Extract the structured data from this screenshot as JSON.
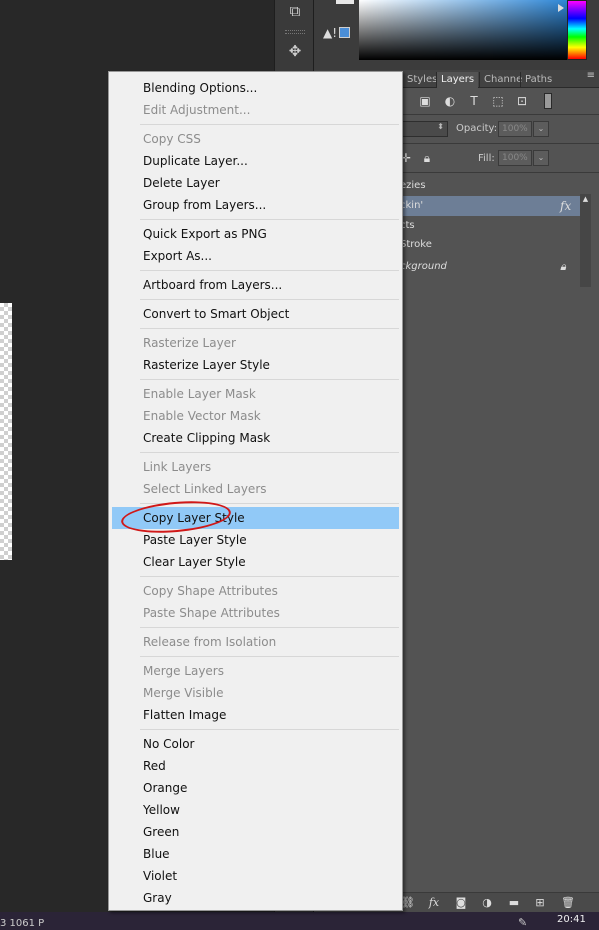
{
  "layers_panel": {
    "tabs": [
      {
        "label": "Styles",
        "active": false
      },
      {
        "label": "Layers",
        "active": true
      },
      {
        "label": "Channe",
        "active": false
      },
      {
        "label": "Paths",
        "active": false
      }
    ],
    "opacity_label": "Opacity:",
    "opacity_value": "100%",
    "fill_label": "Fill:",
    "fill_value": "100%",
    "layers": [
      {
        "name": "ezies",
        "selected": false
      },
      {
        "name": "ckin'",
        "selected": true,
        "badge": "fx"
      },
      {
        "name": "cts",
        "selected": false
      },
      {
        "name": "Stroke",
        "selected": false
      },
      {
        "name": "ckground",
        "selected": false,
        "locked": true
      }
    ]
  },
  "context_menu": {
    "items": [
      {
        "label": "Blending Options...",
        "enabled": true
      },
      {
        "label": "Edit Adjustment...",
        "enabled": false
      },
      {
        "label": "Copy CSS",
        "enabled": false
      },
      {
        "label": "Duplicate Layer...",
        "enabled": true
      },
      {
        "label": "Delete Layer",
        "enabled": true
      },
      {
        "label": "Group from Layers...",
        "enabled": true
      },
      {
        "label": "Quick Export as PNG",
        "enabled": true
      },
      {
        "label": "Export As...",
        "enabled": true
      },
      {
        "label": "Artboard from Layers...",
        "enabled": true
      },
      {
        "label": "Convert to Smart Object",
        "enabled": true
      },
      {
        "label": "Rasterize Layer",
        "enabled": false
      },
      {
        "label": "Rasterize Layer Style",
        "enabled": true
      },
      {
        "label": "Enable Layer Mask",
        "enabled": false
      },
      {
        "label": "Enable Vector Mask",
        "enabled": false
      },
      {
        "label": "Create Clipping Mask",
        "enabled": true
      },
      {
        "label": "Link Layers",
        "enabled": false
      },
      {
        "label": "Select Linked Layers",
        "enabled": false
      },
      {
        "label": "Copy Layer Style",
        "enabled": true,
        "highlighted": true
      },
      {
        "label": "Paste Layer Style",
        "enabled": true
      },
      {
        "label": "Clear Layer Style",
        "enabled": true
      },
      {
        "label": "Copy Shape Attributes",
        "enabled": false
      },
      {
        "label": "Paste Shape Attributes",
        "enabled": false
      },
      {
        "label": "Release from Isolation",
        "enabled": false
      },
      {
        "label": "Merge Layers",
        "enabled": false
      },
      {
        "label": "Merge Visible",
        "enabled": false
      },
      {
        "label": "Flatten Image",
        "enabled": true
      },
      {
        "label": "No Color",
        "enabled": true
      },
      {
        "label": "Red",
        "enabled": true
      },
      {
        "label": "Orange",
        "enabled": true
      },
      {
        "label": "Yellow",
        "enabled": true
      },
      {
        "label": "Green",
        "enabled": true
      },
      {
        "label": "Blue",
        "enabled": true
      },
      {
        "label": "Violet",
        "enabled": true
      },
      {
        "label": "Gray",
        "enabled": true
      }
    ]
  },
  "taskbar": {
    "status_text": "3 1061 P",
    "clock": "20:41"
  },
  "colors": {
    "highlight": "#91c9f7",
    "annotation_circle": "#d01818",
    "selected_layer": "#6d7e96"
  },
  "icons": {
    "tools": [
      "artboard-tool-icon",
      "puppet-warp-icon"
    ],
    "filter": [
      "image-filter-icon",
      "adjustment-filter-icon",
      "type-filter-icon",
      "shape-filter-icon",
      "smart-object-filter-icon"
    ],
    "bottom": [
      "link-icon",
      "fx-icon",
      "mask-icon",
      "adjustment-icon",
      "group-icon",
      "new-layer-icon",
      "trash-icon"
    ]
  }
}
